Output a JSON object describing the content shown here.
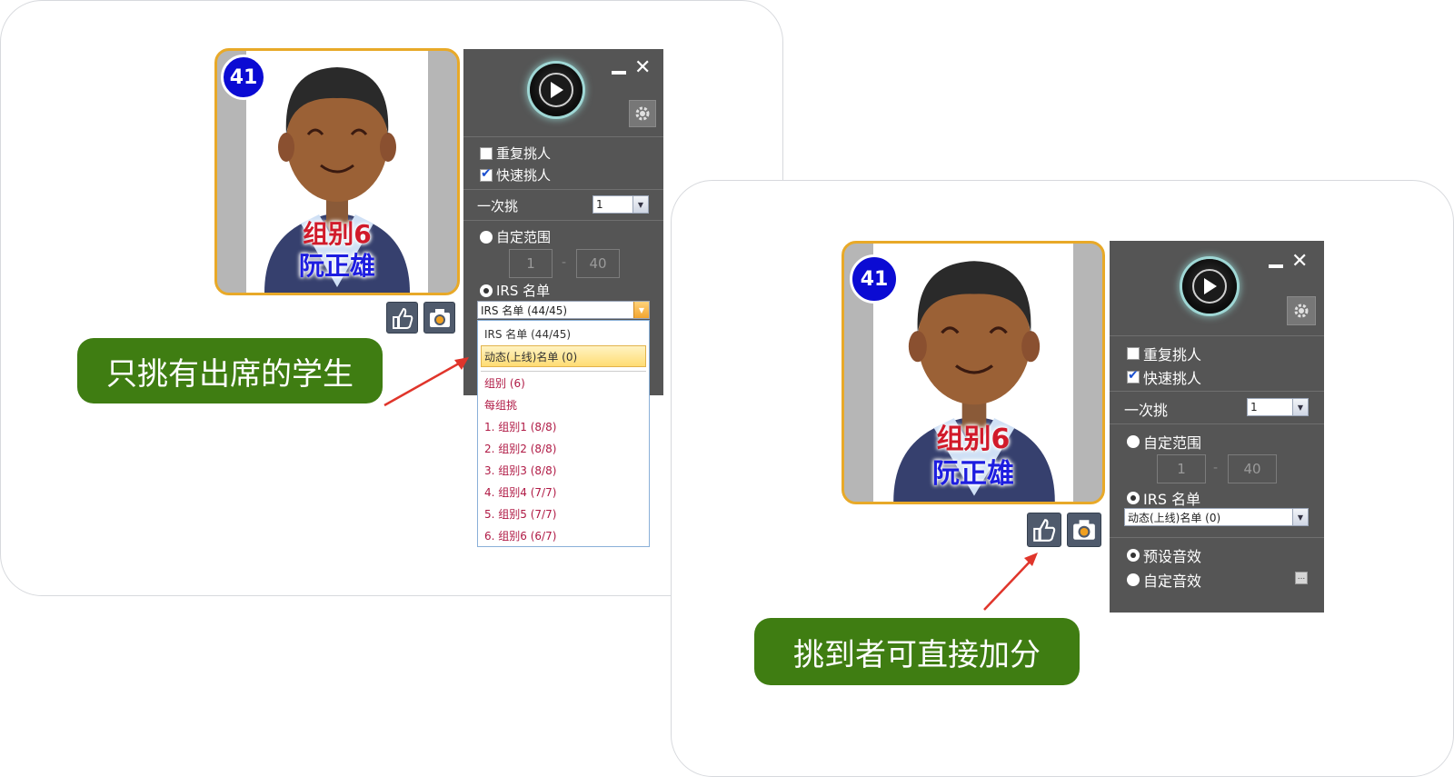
{
  "left_panel": {
    "student": {
      "number": "41",
      "group": "组别6",
      "name": "阮正雄"
    },
    "options": {
      "repeat_pick": {
        "label": "重复挑人",
        "checked": false
      },
      "quick_pick": {
        "label": "快速挑人",
        "checked": true
      }
    },
    "pick_once": {
      "label": "一次挑",
      "value": "1"
    },
    "custom_range": {
      "label": "自定范围",
      "from": "1",
      "separator": "-",
      "to": "40"
    },
    "irs_list": {
      "label": "IRS 名单",
      "selected": "IRS 名单 (44/45)"
    },
    "dropdown_options": [
      "IRS 名单 (44/45)",
      "动态(上线)名单 (0)",
      "组别 (6)",
      "每组挑",
      "1. 组别1 (8/8)",
      "2. 组别2 (8/8)",
      "3. 组别3 (8/8)",
      "4. 组别4 (7/7)",
      "5. 组别5 (7/7)",
      "6. 组别6 (6/7)"
    ],
    "highlighted_option": "动态(上线)名单 (0)"
  },
  "right_panel": {
    "student": {
      "number": "41",
      "group": "组别6",
      "name": "阮正雄"
    },
    "options": {
      "repeat_pick": {
        "label": "重复挑人",
        "checked": false
      },
      "quick_pick": {
        "label": "快速挑人",
        "checked": true
      }
    },
    "pick_once": {
      "label": "一次挑",
      "value": "1"
    },
    "custom_range": {
      "label": "自定范围",
      "from": "1",
      "separator": "-",
      "to": "40"
    },
    "irs_list": {
      "label": "IRS 名单",
      "selected": "动态(上线)名单 (0)"
    },
    "sound": {
      "default_sound": {
        "label": "预设音效",
        "checked": true
      },
      "custom_sound": {
        "label": "自定音效",
        "checked": false
      },
      "browse": "..."
    }
  },
  "callouts": {
    "left": "只挑有出席的学生",
    "right": "挑到者可直接加分"
  },
  "colors": {
    "panel_bg": "#555555",
    "card_border": "#e8a928",
    "badge": "#0b0bd3",
    "callout_bg": "#3f7d12",
    "arrow": "#e0352b",
    "group_text": "#d11a2a",
    "name_text": "#1d1de0"
  }
}
